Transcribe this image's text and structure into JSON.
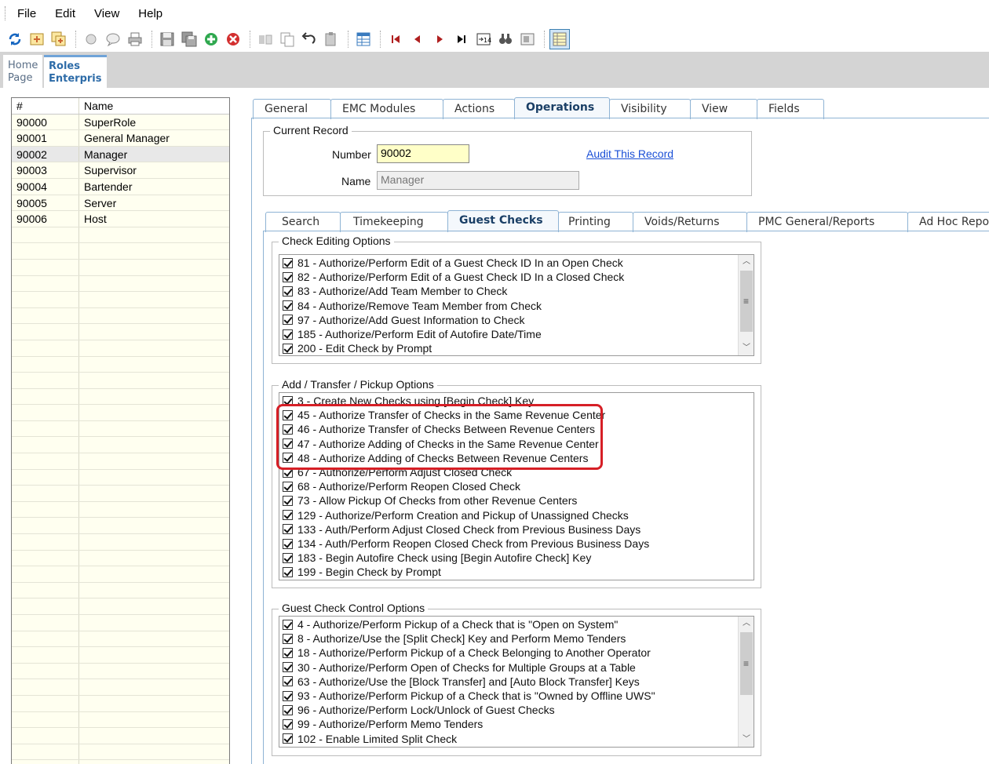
{
  "menu": [
    "File",
    "Edit",
    "View",
    "Help"
  ],
  "toolbar_icons": [
    "refresh-icon",
    "new-icon",
    "new-copy-icon",
    "record-icon",
    "comment-icon",
    "print-icon",
    "save-icon",
    "save-all-icon",
    "add-icon",
    "delete-icon",
    "move-icon",
    "copy-icon",
    "undo-icon",
    "clipboard-icon",
    "table-icon",
    "first-icon",
    "prev-icon",
    "next-icon",
    "last-icon",
    "goto-icon",
    "find-icon",
    "view-icon",
    "grid-icon"
  ],
  "page_tabs": {
    "home": "Home Page",
    "roles": "Roles Enterpris"
  },
  "left_table": {
    "headers": [
      "#",
      "Name"
    ],
    "rows": [
      {
        "id": "90000",
        "name": "SuperRole"
      },
      {
        "id": "90001",
        "name": "General Manager"
      },
      {
        "id": "90002",
        "name": "Manager"
      },
      {
        "id": "90003",
        "name": "Supervisor"
      },
      {
        "id": "90004",
        "name": "Bartender"
      },
      {
        "id": "90005",
        "name": "Server"
      },
      {
        "id": "90006",
        "name": "Host"
      }
    ],
    "selected_index": 2
  },
  "main_tabs": [
    "General",
    "EMC Modules",
    "Actions",
    "Operations",
    "Visibility",
    "View",
    "Fields"
  ],
  "main_active": "Operations",
  "current_record": {
    "title": "Current Record",
    "number_label": "Number",
    "number_value": "90002",
    "name_label": "Name",
    "name_value": "Manager",
    "audit_link": "Audit This Record"
  },
  "sub_tabs": [
    "Search",
    "Timekeeping",
    "Guest Checks",
    "Printing",
    "Voids/Returns",
    "PMC General/Reports",
    "Ad Hoc Repor"
  ],
  "sub_active": "Guest Checks",
  "groups": {
    "check_editing": {
      "title": "Check Editing Options",
      "items": [
        "81 - Authorize/Perform Edit of a Guest Check ID In an Open Check",
        "82 - Authorize/Perform Edit of a Guest Check ID In a Closed Check",
        "83 - Authorize/Add Team Member to Check",
        "84 - Authorize/Remove Team Member from Check",
        "97 - Authorize/Add Guest Information to Check",
        "185 - Authorize/Perform Edit of Autofire Date/Time",
        "200 - Edit Check by Prompt"
      ]
    },
    "transfer": {
      "title": "Add / Transfer / Pickup Options",
      "items": [
        "3 - Create New Checks using [Begin Check] Key",
        "45 - Authorize Transfer of Checks in the Same Revenue Center",
        "46 - Authorize Transfer of Checks Between Revenue Centers",
        "47 - Authorize Adding of Checks in the Same Revenue Center",
        "48 - Authorize Adding of Checks Between Revenue Centers",
        "67 - Authorize/Perform Adjust Closed Check",
        "68 - Authorize/Perform Reopen Closed Check",
        "73 - Allow Pickup Of Checks from other Revenue Centers",
        "129 - Authorize/Perform Creation and Pickup of Unassigned Checks",
        "133 - Auth/Perform Adjust Closed Check from Previous Business Days",
        "134 - Auth/Perform Reopen Closed Check from Previous Business Days",
        "183 - Begin Autofire Check using [Begin Autofire Check] Key",
        "199 - Begin Check by Prompt"
      ]
    },
    "control": {
      "title": "Guest Check Control Options",
      "items": [
        "4 - Authorize/Perform Pickup of a Check that is \"Open on System\"",
        "8 - Authorize/Use the [Split Check] Key and Perform Memo Tenders",
        "18 - Authorize/Perform Pickup of a Check Belonging to Another Operator",
        "30 - Authorize/Perform Open of Checks for Multiple Groups at a Table",
        "63 - Authorize/Use the [Block Transfer] and [Auto Block Transfer] Keys",
        "93 - Authorize/Perform Pickup of a Check that is \"Owned by Offline UWS\"",
        "96 - Authorize/Perform Lock/Unlock of Guest Checks",
        "99 - Authorize/Perform Memo Tenders",
        "102 - Enable Limited Split Check"
      ]
    }
  },
  "colors": {
    "highlight": "#d61f26",
    "tab_border": "#8eb3d4",
    "link": "#1a4fd6"
  }
}
